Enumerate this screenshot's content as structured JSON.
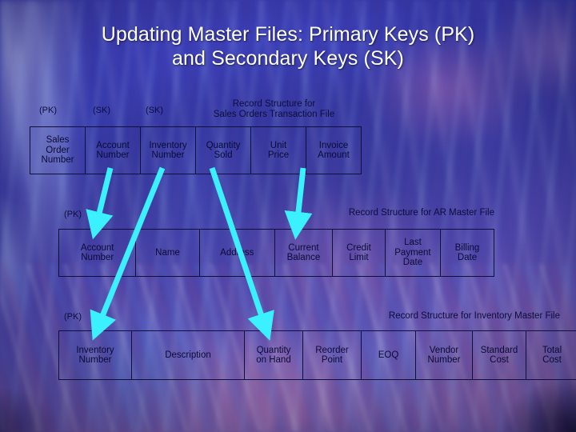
{
  "slide": {
    "title_line1": "Updating Master Files: Primary Keys (PK)",
    "title_line2": "and Secondary Keys (SK)",
    "title_color": "#ffffff",
    "arrow_color": "#3bf0ff",
    "table_border_color": "#10103c",
    "text_color": "#0b0b35"
  },
  "records": [
    {
      "id": "sales-orders-transaction-file",
      "caption_line1": "Record Structure for",
      "caption_line2": "Sales Orders Transaction File",
      "key_labels": [
        {
          "text": "(PK)",
          "column": 0
        },
        {
          "text": "(SK)",
          "column": 1
        },
        {
          "text": "(SK)",
          "column": 2
        }
      ],
      "fields": [
        {
          "lines": [
            "Sales",
            "Order",
            "Number"
          ]
        },
        {
          "lines": [
            "Account",
            "Number"
          ]
        },
        {
          "lines": [
            "Inventory",
            "Number"
          ]
        },
        {
          "lines": [
            "Quantity",
            "Sold"
          ]
        },
        {
          "lines": [
            "Unit",
            "Price"
          ]
        },
        {
          "lines": [
            "Invoice",
            "Amount"
          ]
        }
      ]
    },
    {
      "id": "ar-master-file",
      "caption_line1": "Record Structure for AR Master File",
      "caption_line2": "",
      "key_labels": [
        {
          "text": "(PK)",
          "column": 0
        }
      ],
      "fields": [
        {
          "lines": [
            "Account",
            "Number"
          ]
        },
        {
          "lines": [
            "Name"
          ]
        },
        {
          "lines": [
            "Address"
          ]
        },
        {
          "lines": [
            "Current",
            "Balance"
          ]
        },
        {
          "lines": [
            "Credit",
            "Limit"
          ]
        },
        {
          "lines": [
            "Last",
            "Payment",
            "Date"
          ]
        },
        {
          "lines": [
            "Billing",
            "Date"
          ]
        }
      ]
    },
    {
      "id": "inventory-master-file",
      "caption_line1": "Record Structure for Inventory Master File",
      "caption_line2": "",
      "key_labels": [
        {
          "text": "(PK)",
          "column": 0
        }
      ],
      "fields": [
        {
          "lines": [
            "Inventory",
            "Number"
          ]
        },
        {
          "lines": [
            "Description"
          ]
        },
        {
          "lines": [
            "Quantity",
            "on Hand"
          ]
        },
        {
          "lines": [
            "Reorder",
            "Point"
          ]
        },
        {
          "lines": [
            "EOQ"
          ]
        },
        {
          "lines": [
            "Vendor",
            "Number"
          ]
        },
        {
          "lines": [
            "Standard",
            "Cost"
          ]
        },
        {
          "lines": [
            "Total",
            "Cost"
          ]
        }
      ]
    }
  ],
  "links": [
    {
      "name": "account-number-to-ar-account-number",
      "from_field": "Account Number",
      "to_field": "Account Number"
    },
    {
      "name": "inventory-number-to-inventory-number",
      "from_field": "Inventory Number",
      "to_field": "Inventory Number"
    },
    {
      "name": "quantity-sold-to-quantity-on-hand",
      "from_field": "Quantity Sold",
      "to_field": "Quantity on Hand"
    },
    {
      "name": "invoice-amount-to-current-balance",
      "from_field": "Invoice Amount",
      "to_field": "Current Balance"
    }
  ]
}
